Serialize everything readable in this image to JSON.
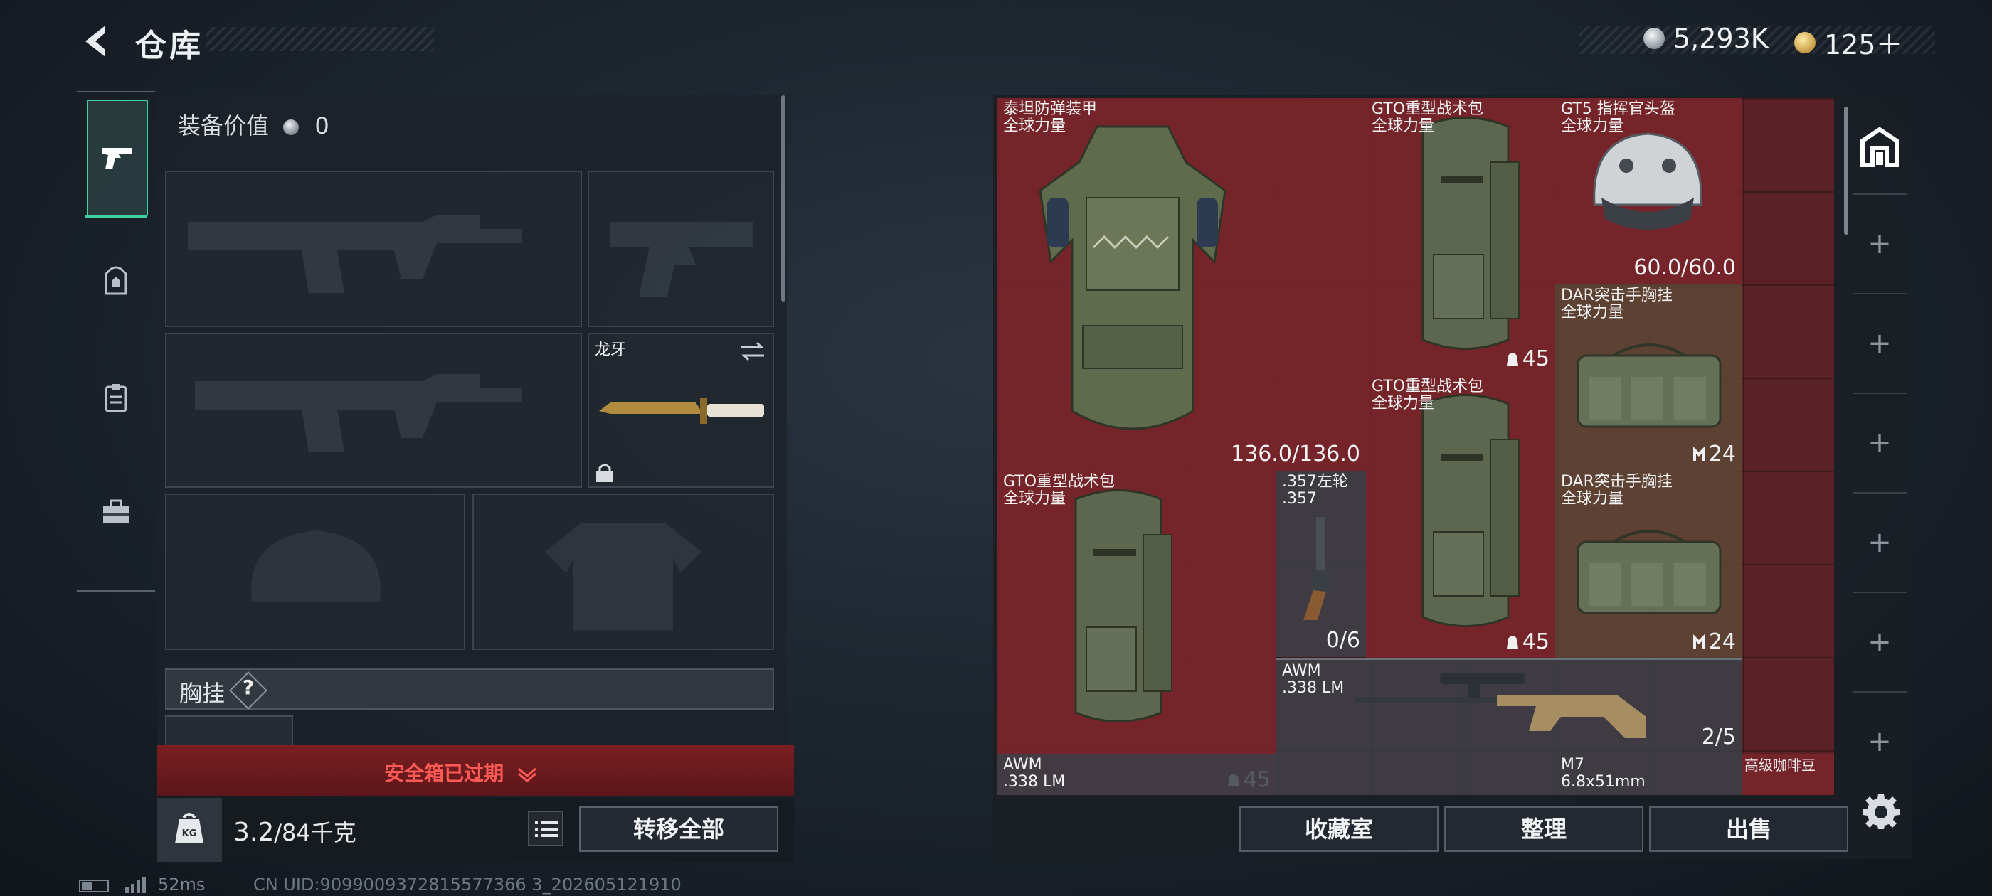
{
  "header": {
    "title": "仓库",
    "currency": [
      {
        "icon": "silver-coin-icon",
        "value": "5,293K"
      },
      {
        "icon": "gold-coin-icon",
        "value": "125＋"
      }
    ]
  },
  "sidebar": {
    "items": [
      {
        "icon": "pistol-icon",
        "active": true
      },
      {
        "icon": "backpack-icon",
        "active": false
      },
      {
        "icon": "vest-icon",
        "active": false
      },
      {
        "icon": "toolbox-icon",
        "active": false
      }
    ]
  },
  "loadout": {
    "equip_value_label": "装备价值",
    "equip_value": "0",
    "melee_name": "龙牙",
    "chest_rig_label": "胸挂",
    "chest_help": "?",
    "safe_box_status": "安全箱已过期",
    "weight_current": "3.2",
    "weight_max": "/84千克",
    "kg_icon_label": "KG",
    "transfer_all": "转移全部"
  },
  "status": {
    "ping": "52ms",
    "uid": "CN UID:9099009372815577366 3_202605121910"
  },
  "stash": {
    "items": [
      {
        "name": "泰坦防弹装甲",
        "sub": "全球力量",
        "value": "136.0/136.0",
        "bg": "red"
      },
      {
        "name": "GTO重型战术包",
        "sub": "全球力量",
        "value": "45",
        "bg": "red"
      },
      {
        "name": "GT5 指挥官头盔",
        "sub": "全球力量",
        "value": "60.0/60.0",
        "bg": "red"
      },
      {
        "name": "DAR突击手胸挂",
        "sub": "全球力量",
        "value": "24",
        "bg": "olive"
      },
      {
        "name": "GTO重型战术包",
        "sub": "全球力量",
        "value": "45",
        "bg": "red"
      },
      {
        "name": "GTO重型战术包",
        "sub": "全球力量",
        "value": "45",
        "bg": "red"
      },
      {
        "name": ".357左轮",
        "sub": ".357",
        "value": "0/6",
        "bg": "dark"
      },
      {
        "name": "DAR突击手胸挂",
        "sub": "全球力量",
        "value": "24",
        "bg": "olive"
      },
      {
        "name": "AWM",
        "sub": ".338 LM",
        "value": "2/5",
        "bg": "dark"
      },
      {
        "name": "AWM",
        "sub": ".338 LM",
        "value": "",
        "bg": "dark"
      },
      {
        "name": "M7",
        "sub": "6.8x51mm",
        "value": "",
        "bg": "dark"
      },
      {
        "name": "高级咖啡豆",
        "sub": "",
        "value": "",
        "bg": "red"
      }
    ],
    "actions": [
      "收藏室",
      "整理",
      "出售"
    ]
  },
  "colors": {
    "accent": "#3fd0a0",
    "stash_red": "#7a262c",
    "safe_box_red": "#ff5a55"
  }
}
